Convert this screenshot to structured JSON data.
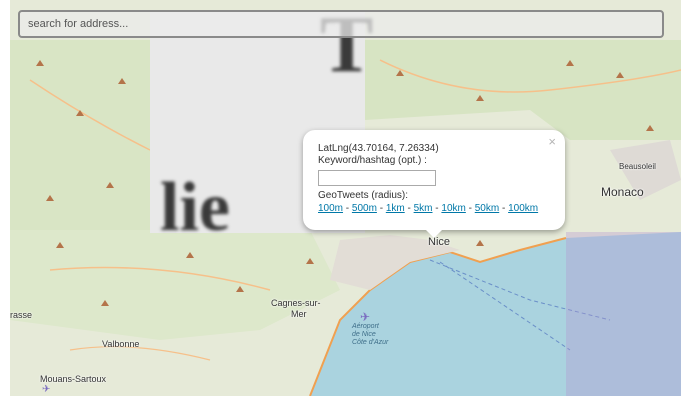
{
  "search": {
    "placeholder": "search for address..."
  },
  "popup": {
    "close": "×",
    "latlng": "LatLng(43.70164, 7.26334)",
    "keyword_label": "Keyword/hashtag (opt.) :",
    "keyword_value": "",
    "geotweets_label": "GeoTweets (radius):",
    "radius_links": [
      "100m",
      "500m",
      "1km",
      "5km",
      "10km",
      "50km",
      "100km"
    ],
    "separator": " - "
  },
  "map": {
    "places": {
      "monaco": "Monaco",
      "beausoleil": "Beausoleil",
      "nice": "Nice",
      "cagnes_sur_mer_line1": "Cagnes-sur-",
      "cagnes_sur_mer_line2": "Mer",
      "valbonne": "Valbonne",
      "mouans_sartoux": "Mouans-Sartoux",
      "grasse": "rasse",
      "airport_line1": "Aéroport",
      "airport_line2": "de Nice",
      "airport_line3": "Côte d'Azur"
    },
    "blurred_tile_text": {
      "top": "T",
      "bottom": "lie"
    },
    "colors": {
      "sea": "#aad3df",
      "land": "#e9ecdf",
      "road": "#f3a65a",
      "link": "#0078a8"
    }
  }
}
